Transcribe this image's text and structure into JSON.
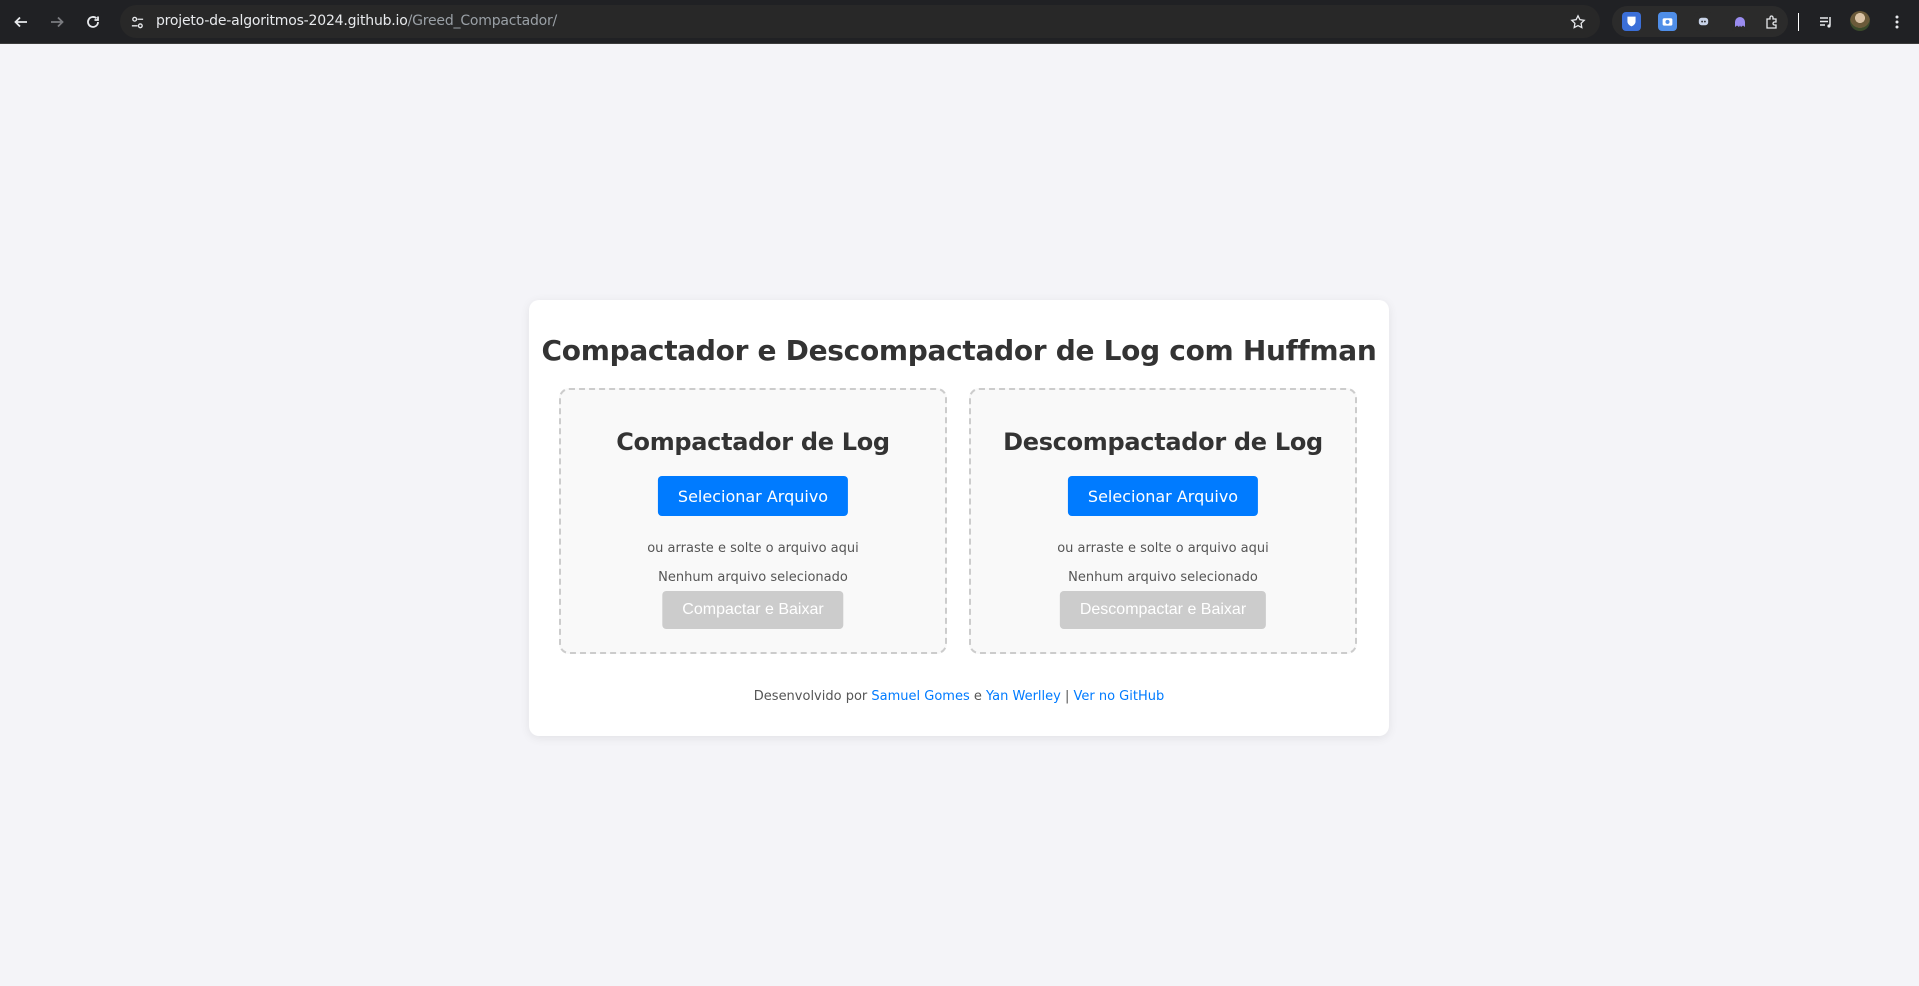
{
  "browser": {
    "url_host": "projeto-de-algoritmos-2024.github.io",
    "url_path": "/Greed_Compactador/",
    "icons": {
      "back": "arrow-left-icon",
      "forward": "arrow-right-icon",
      "reload": "reload-icon",
      "site_info": "tune-icon",
      "bookmark": "star-icon",
      "extensions": "puzzle-icon",
      "media": "playlist-icon",
      "menu": "kebab-menu-icon"
    }
  },
  "page": {
    "title": "Compactador e Descompactador de Log com Huffman",
    "compressor": {
      "heading": "Compactador de Log",
      "select_label": "Selecionar Arquivo",
      "drop_hint": "ou arraste e solte o arquivo aqui",
      "status": "Nenhum arquivo selecionado",
      "action_label": "Compactar e Baixar"
    },
    "decompressor": {
      "heading": "Descompactador de Log",
      "select_label": "Selecionar Arquivo",
      "drop_hint": "ou arraste e solte o arquivo aqui",
      "status": "Nenhum arquivo selecionado",
      "action_label": "Descompactar e Baixar"
    },
    "footer": {
      "prefix": "Desenvolvido por ",
      "author1": "Samuel Gomes",
      "conj": " e ",
      "author2": "Yan Werlley",
      "sep": " | ",
      "github_link": "Ver no GitHub"
    }
  },
  "colors": {
    "background": "#f4f4f8",
    "primary": "#007bff",
    "disabled": "#cccccc",
    "text": "#333333"
  }
}
